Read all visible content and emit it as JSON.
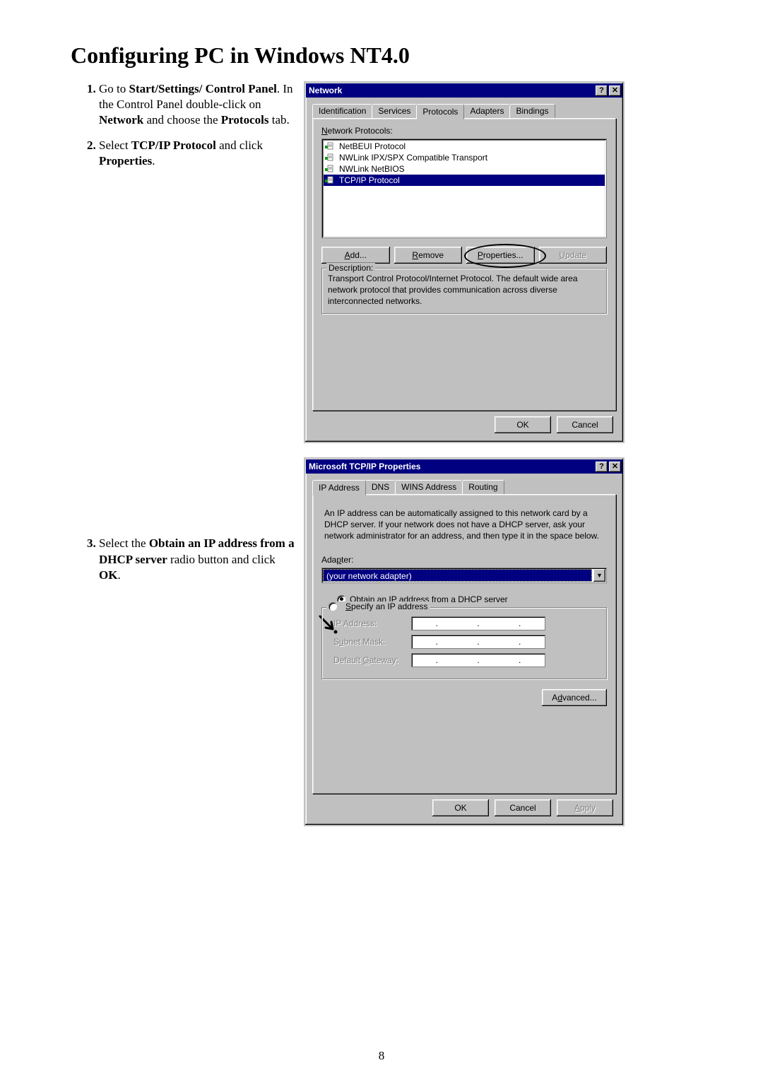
{
  "page": {
    "heading": "Configuring PC in Windows NT4.0",
    "number": "8"
  },
  "instructions": {
    "step1": {
      "pre": "Go to ",
      "bold1": "Start/Settings/ Control Panel",
      "mid1": ". In the Control Panel double-click on ",
      "bold2": "Network",
      "mid2": " and choose the ",
      "bold3": "Protocols",
      "post": " tab."
    },
    "step2": {
      "pre": "Select ",
      "bold1": "TCP/IP Protocol",
      "mid1": " and click ",
      "bold2": "Properties",
      "post": "."
    },
    "step3": {
      "pre": "Select the ",
      "bold1": "Obtain an IP address from a DHCP server",
      "mid1": " radio button and click ",
      "bold2": "OK",
      "post": "."
    }
  },
  "network_dialog": {
    "title": "Network",
    "help_glyph": "?",
    "close_glyph": "✕",
    "tabs": {
      "identification": "Identification",
      "services": "Services",
      "protocols": "Protocols",
      "adapters": "Adapters",
      "bindings": "Bindings"
    },
    "list_label_pre": "N",
    "list_label_rest": "etwork Protocols:",
    "protocols": {
      "netbeui": "NetBEUI Protocol",
      "ipxspx": "NWLink IPX/SPX Compatible Transport",
      "nwnetbios": "NWLink NetBIOS",
      "tcpip": "TCP/IP Protocol"
    },
    "buttons": {
      "add_u": "A",
      "add_rest": "dd...",
      "remove_u": "R",
      "remove_rest": "emove",
      "properties_u": "P",
      "properties_rest": "roperties...",
      "update_u": "U",
      "update_rest": "pdate"
    },
    "desc_legend": "Description:",
    "desc_text": "Transport Control Protocol/Internet Protocol. The default wide area network protocol that provides communication across diverse interconnected networks.",
    "ok": "OK",
    "cancel": "Cancel"
  },
  "tcpip_dialog": {
    "title": "Microsoft TCP/IP Properties",
    "help_glyph": "?",
    "close_glyph": "✕",
    "tabs": {
      "ip": "IP Address",
      "dns": "DNS",
      "wins": "WINS Address",
      "routing": "Routing"
    },
    "explain": "An IP address can be automatically assigned to this network card by a DHCP server. If your network does not have a DHCP server, ask your network administrator for an address, and then type it in the space below.",
    "adapter_label_pre": "Ada",
    "adapter_label_u": "p",
    "adapter_label_post": "ter:",
    "adapter_value": "(your network adapter)",
    "radio_obtain_u": "O",
    "radio_obtain_rest": "btain an IP address from a DHCP server",
    "radio_specify_u": "S",
    "radio_specify_rest": "pecify an IP address",
    "fields": {
      "ip_pre": "I",
      "ip_rest": "P Address:",
      "mask_pre": "S",
      "mask_u": "u",
      "mask_rest": "bnet Mask:",
      "gw_pre": "Default ",
      "gw_u": "G",
      "gw_rest": "ateway:"
    },
    "dot": ".",
    "advanced_pre": "A",
    "advanced_u": "d",
    "advanced_rest": "vanced...",
    "ok": "OK",
    "cancel": "Cancel",
    "apply_pre": "A",
    "apply_rest": "pply"
  }
}
